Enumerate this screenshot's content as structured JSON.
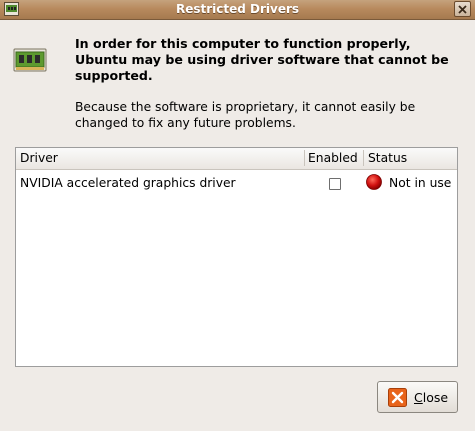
{
  "window": {
    "title": "Restricted Drivers"
  },
  "message": {
    "primary": "In order for this computer to function properly, Ubuntu may be using driver software that cannot be supported.",
    "secondary": "Because the software is proprietary, it cannot easily be changed to fix any future problems."
  },
  "table": {
    "columns": [
      "Driver",
      "Enabled",
      "Status"
    ],
    "rows": [
      {
        "driver": "NVIDIA accelerated graphics driver",
        "enabled": false,
        "status": "Not in use",
        "status_color": "#cc0000"
      }
    ]
  },
  "buttons": {
    "close_mnemonic": "C",
    "close_rest": "lose"
  },
  "colors": {
    "titlebar": "#b88a5e",
    "close_icon": "#e8641b"
  }
}
